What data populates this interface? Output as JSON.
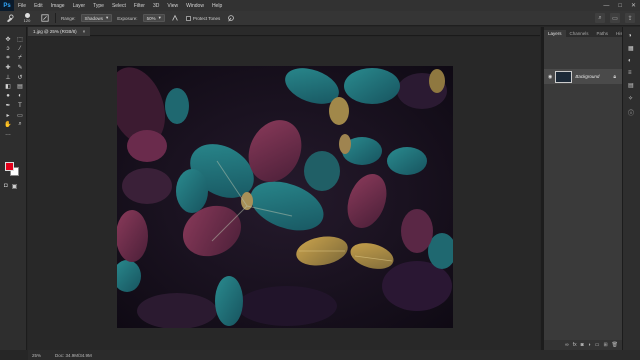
{
  "menubar": {
    "logo": "Ps",
    "items": [
      "File",
      "Edit",
      "Image",
      "Layer",
      "Type",
      "Select",
      "Filter",
      "3D",
      "View",
      "Window",
      "Help"
    ],
    "controls": {
      "minimize": "—",
      "maximize": "□",
      "close": "✕"
    }
  },
  "options": {
    "size_value": "120",
    "range_label": "Range:",
    "range_value": "Shadows",
    "exposure_label": "Exposure:",
    "exposure_value": "50%",
    "protect_label": "Protect Tones"
  },
  "document": {
    "tab_title": "1.jpg @ 25% (RGB/8)",
    "close": "×"
  },
  "panel": {
    "tabs": [
      "Layers",
      "Channels",
      "Paths",
      "History"
    ],
    "layer_name": "Background"
  },
  "status": {
    "zoom": "25%",
    "doc_info": "Doc: 34.9M/34.9M"
  },
  "colors": {
    "foreground": "#e3001b",
    "background": "#ffffff",
    "app_accent": "#31a8ff"
  },
  "icons": {
    "options_tool": "burn-tool-icon",
    "toolbar": [
      "move-icon",
      "marquee-icon",
      "lasso-icon",
      "magic-wand-icon",
      "crop-icon",
      "eyedropper-icon",
      "healing-brush-icon",
      "brush-icon",
      "clone-stamp-icon",
      "history-brush-icon",
      "eraser-icon",
      "gradient-icon",
      "blur-icon",
      "dodge-icon",
      "pen-icon",
      "type-icon",
      "path-select-icon",
      "rectangle-icon",
      "hand-icon",
      "zoom-icon"
    ]
  }
}
